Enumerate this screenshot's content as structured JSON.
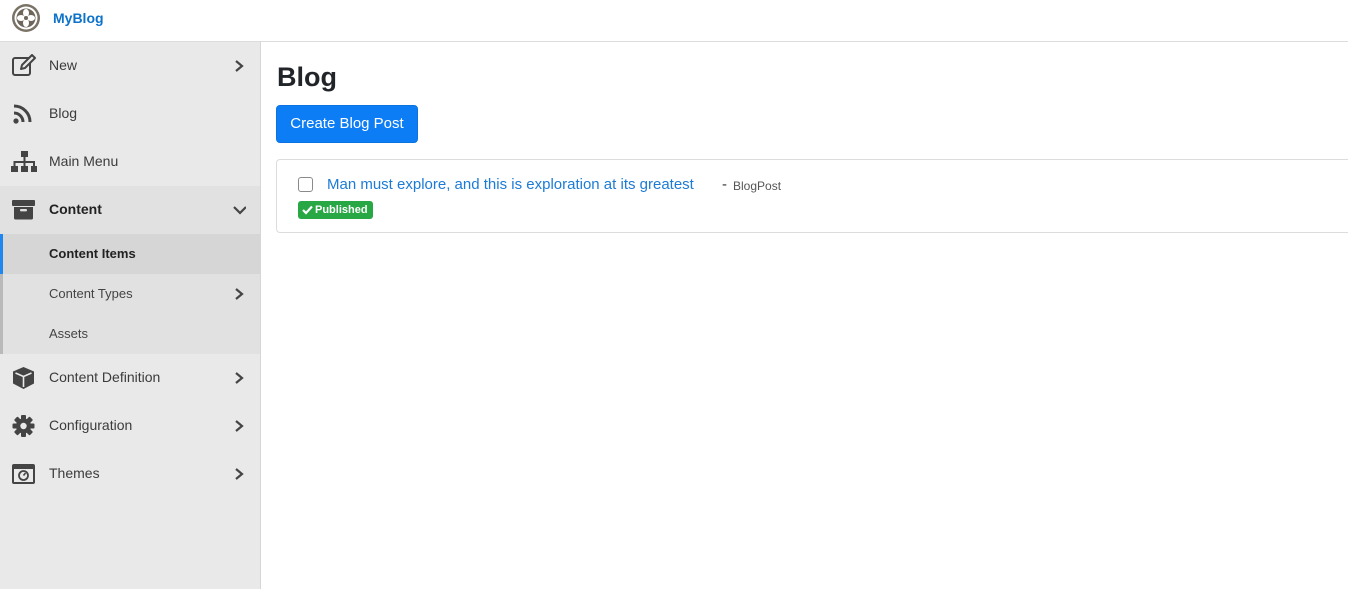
{
  "app": {
    "brand": "MyBlog"
  },
  "sidebar": {
    "items": [
      {
        "label": "New",
        "icon": "edit-icon"
      },
      {
        "label": "Blog",
        "icon": "rss-icon"
      },
      {
        "label": "Main Menu",
        "icon": "sitemap-icon"
      },
      {
        "label": "Content",
        "icon": "archive-icon",
        "expanded": true
      },
      {
        "label": "Content Definition",
        "icon": "cube-icon"
      },
      {
        "label": "Configuration",
        "icon": "gear-icon"
      },
      {
        "label": "Themes",
        "icon": "theme-icon"
      }
    ],
    "content_submenu": [
      {
        "label": "Content Items",
        "active": true
      },
      {
        "label": "Content Types"
      },
      {
        "label": "Assets"
      }
    ]
  },
  "main": {
    "title": "Blog",
    "create_button": "Create Blog Post",
    "items": [
      {
        "title": "Man must explore, and this is exploration at its greatest",
        "separator": "-",
        "type": "BlogPost",
        "status": "Published"
      }
    ]
  },
  "colors": {
    "brand": "#0d72c9",
    "primary_button": "#0d7df6",
    "link": "#1c7bd6",
    "published_badge": "#28a745",
    "active_indicator": "#1e87f0",
    "sidebar_bg": "#e9e9e9"
  }
}
